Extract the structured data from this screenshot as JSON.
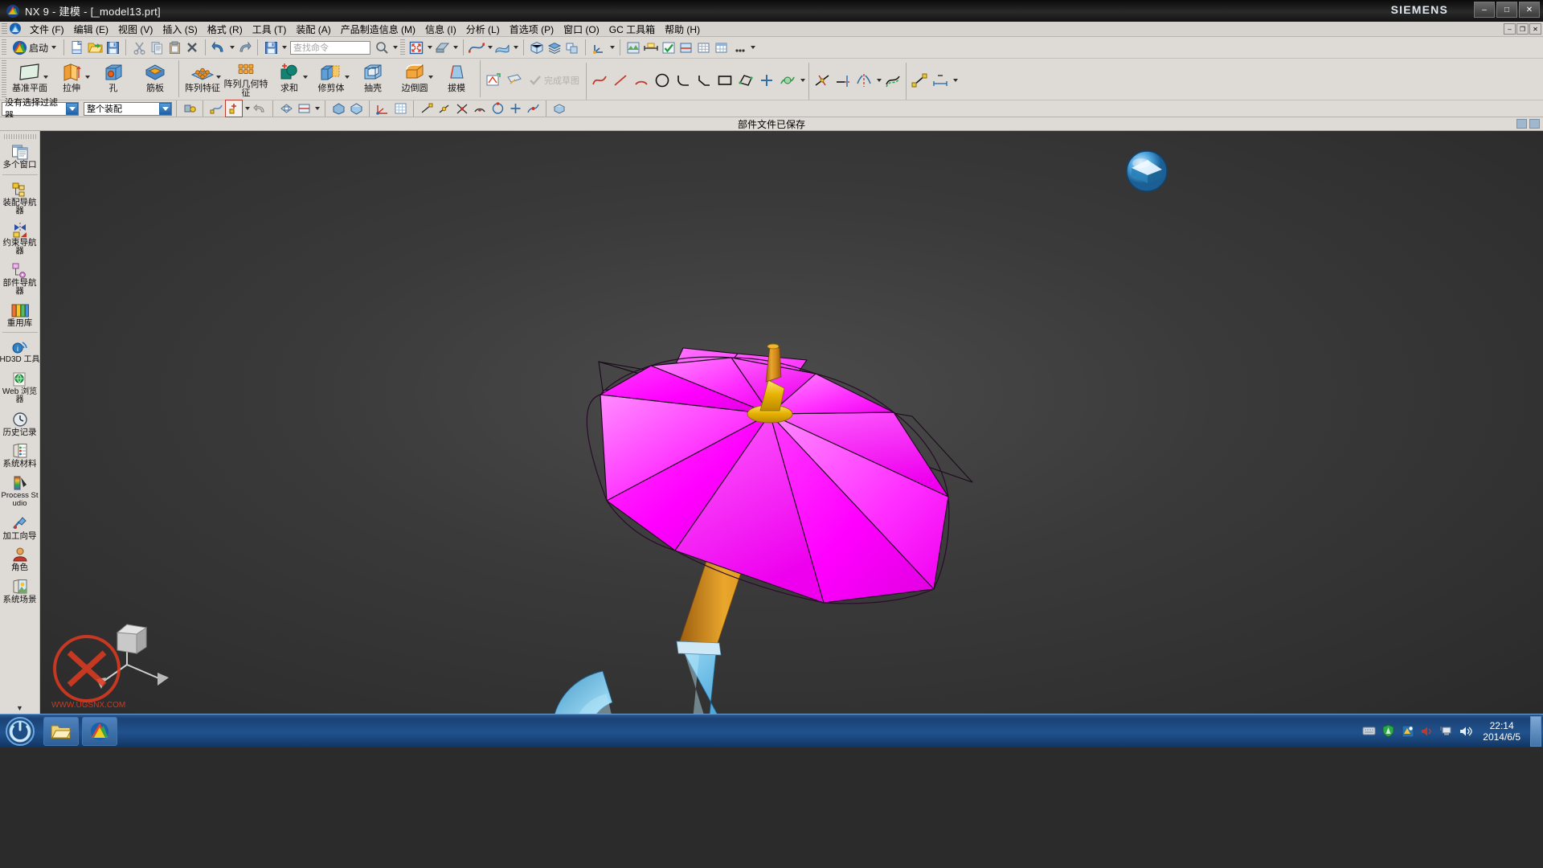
{
  "titlebar": {
    "title": "NX 9 - 建模 - [_model13.prt]",
    "brand": "SIEMENS",
    "icon": "nx-logo-icon",
    "buttons": [
      {
        "name": "minimize",
        "glyph": "–"
      },
      {
        "name": "maximize",
        "glyph": "□"
      },
      {
        "name": "close",
        "glyph": "✕"
      }
    ]
  },
  "menubar": {
    "app_icon": "nx-app-icon",
    "items": [
      {
        "label": "文件 (F)",
        "name": "menu-file"
      },
      {
        "label": "编辑 (E)",
        "name": "menu-edit"
      },
      {
        "label": "视图 (V)",
        "name": "menu-view"
      },
      {
        "label": "插入 (S)",
        "name": "menu-insert"
      },
      {
        "label": "格式 (R)",
        "name": "menu-format"
      },
      {
        "label": "工具 (T)",
        "name": "menu-tools"
      },
      {
        "label": "装配 (A)",
        "name": "menu-assemblies"
      },
      {
        "label": "产品制造信息 (M)",
        "name": "menu-pmi"
      },
      {
        "label": "信息 (I)",
        "name": "menu-information"
      },
      {
        "label": "分析 (L)",
        "name": "menu-analysis"
      },
      {
        "label": "首选项 (P)",
        "name": "menu-preferences"
      },
      {
        "label": "窗口 (O)",
        "name": "menu-window"
      },
      {
        "label": "GC 工具箱",
        "name": "menu-gc-toolkit"
      },
      {
        "label": "帮助 (H)",
        "name": "menu-help"
      }
    ],
    "window_buttons": [
      {
        "name": "doc-minimize",
        "glyph": "–"
      },
      {
        "name": "doc-restore",
        "glyph": "❐"
      },
      {
        "name": "doc-close",
        "glyph": "✕"
      }
    ]
  },
  "toolbar": {
    "start_label": "启动",
    "find_placeholder": "查找命令",
    "buttons": [
      {
        "name": "start-button",
        "icon": "nx-start-icon"
      },
      {
        "name": "new-button",
        "icon": "new-document-icon"
      },
      {
        "name": "open-button",
        "icon": "open-folder-icon"
      },
      {
        "name": "save-button",
        "icon": "save-disk-icon"
      },
      {
        "name": "cut-button",
        "icon": "scissors-icon"
      },
      {
        "name": "copy-button",
        "icon": "copy-icon"
      },
      {
        "name": "paste-button",
        "icon": "clipboard-icon"
      },
      {
        "name": "delete-button",
        "icon": "delete-x-icon"
      },
      {
        "name": "undo-button",
        "icon": "undo-arrow-icon"
      },
      {
        "name": "redo-button",
        "icon": "redo-arrow-icon"
      },
      {
        "name": "save-as-button",
        "icon": "save-disk-icon"
      },
      {
        "name": "find-command-input",
        "icon": "search-icon"
      },
      {
        "name": "search-button",
        "icon": "magnifier-icon"
      },
      {
        "name": "fit-view-button",
        "icon": "fit-window-icon"
      },
      {
        "name": "zoom-button",
        "icon": "zoom-icon"
      },
      {
        "name": "pan-button",
        "icon": "pan-hand-icon"
      },
      {
        "name": "rotate-button",
        "icon": "rotate-icon"
      },
      {
        "name": "perspective-button",
        "icon": "perspective-icon"
      },
      {
        "name": "shaded-button",
        "icon": "shaded-render-icon"
      },
      {
        "name": "orient-view-button",
        "icon": "orient-view-icon"
      },
      {
        "name": "layer-settings-button",
        "icon": "layers-icon"
      },
      {
        "name": "move-layer-button",
        "icon": "move-layer-icon"
      },
      {
        "name": "wcs-button",
        "icon": "wcs-icon"
      },
      {
        "name": "measure-button",
        "icon": "measure-icon"
      },
      {
        "name": "material-button",
        "icon": "material-icon"
      },
      {
        "name": "analysis-button",
        "icon": "analysis-icon"
      },
      {
        "name": "check-geometry-button",
        "icon": "check-icon"
      },
      {
        "name": "section-button",
        "icon": "section-icon"
      },
      {
        "name": "grid-button",
        "icon": "grid-icon"
      },
      {
        "name": "table-button",
        "icon": "table-icon"
      },
      {
        "name": "more-button",
        "icon": "more-icon"
      }
    ]
  },
  "ribbon": {
    "groups": [
      {
        "name": "feature-group",
        "items": [
          {
            "label": "基准平面",
            "name": "datum-plane",
            "icon": "datum-plane-icon",
            "dropdown": true
          },
          {
            "label": "拉伸",
            "name": "extrude",
            "icon": "extrude-icon",
            "dropdown": true
          },
          {
            "label": "孔",
            "name": "hole",
            "icon": "hole-icon",
            "dropdown": false
          },
          {
            "label": "筋板",
            "name": "rib",
            "icon": "rib-icon",
            "dropdown": false
          }
        ]
      },
      {
        "name": "detail-group",
        "items": [
          {
            "label": "阵列特征",
            "name": "pattern-feature",
            "icon": "pattern-feature-icon",
            "dropdown": true
          },
          {
            "label": "阵列几何特征",
            "name": "pattern-geometry",
            "icon": "pattern-geometry-icon",
            "dropdown": false
          },
          {
            "label": "求和",
            "name": "unite",
            "icon": "unite-icon",
            "dropdown": true
          },
          {
            "label": "修剪体",
            "name": "trim-body",
            "icon": "trim-body-icon",
            "dropdown": true
          },
          {
            "label": "抽壳",
            "name": "shell",
            "icon": "shell-icon",
            "dropdown": false
          },
          {
            "label": "边倒圆",
            "name": "edge-blend",
            "icon": "edge-blend-icon",
            "dropdown": true
          },
          {
            "label": "拔模",
            "name": "draft",
            "icon": "draft-icon",
            "dropdown": false
          }
        ]
      },
      {
        "name": "sketch-group",
        "items": [
          {
            "label": "完成草图",
            "name": "finish-sketch",
            "icon": "finish-sketch-icon"
          }
        ],
        "tools": [
          {
            "name": "sketch-in-task-icon",
            "icon": "sketch-task-icon"
          },
          {
            "name": "sketch-on-plane-icon",
            "icon": "sketch-plane-icon"
          },
          {
            "name": "profile-icon",
            "icon": "profile-curve-icon"
          },
          {
            "name": "line-icon",
            "icon": "line-icon"
          },
          {
            "name": "arc-icon",
            "icon": "arc-icon"
          },
          {
            "name": "circle-icon",
            "icon": "circle-icon"
          },
          {
            "name": "fillet-icon",
            "icon": "fillet-icon"
          },
          {
            "name": "chamfer-icon",
            "icon": "chamfer-icon"
          },
          {
            "name": "rectangle-icon",
            "icon": "rectangle-icon"
          },
          {
            "name": "polygon-icon",
            "icon": "polygon-icon"
          },
          {
            "name": "point-icon",
            "icon": "point-plus-icon"
          },
          {
            "name": "studio-spline-icon",
            "icon": "spline-icon"
          },
          {
            "name": "quick-trim-icon",
            "icon": "quick-trim-icon"
          },
          {
            "name": "quick-extend-icon",
            "icon": "quick-extend-icon"
          },
          {
            "name": "mirror-curve-icon",
            "icon": "mirror-curve-icon"
          },
          {
            "name": "offset-curve-icon",
            "icon": "offset-curve-icon"
          },
          {
            "name": "geometric-constraint-icon",
            "icon": "constraint-icon"
          },
          {
            "name": "dimension-icon",
            "icon": "dimension-icon"
          }
        ]
      }
    ]
  },
  "selection_bar": {
    "filter_value": "没有选择过滤器",
    "scope_value": "整个装配",
    "buttons": [
      {
        "name": "selection-priority-button",
        "icon": "selection-priority-icon"
      },
      {
        "name": "snap-point-button",
        "icon": "snap-point-icon",
        "active": true
      },
      {
        "name": "snap-arc-center-button",
        "icon": "arc-center-icon"
      },
      {
        "name": "snap-quadrant-button",
        "icon": "quadrant-icon"
      },
      {
        "name": "snap-existing-point-button",
        "icon": "existing-point-icon"
      },
      {
        "name": "snap-endpoint-button",
        "icon": "endpoint-icon"
      },
      {
        "name": "snap-midpoint-button",
        "icon": "midpoint-icon"
      },
      {
        "name": "snap-intersection-button",
        "icon": "intersection-icon"
      },
      {
        "name": "snap-center-button",
        "icon": "center-icon"
      },
      {
        "name": "snap-control-point-button",
        "icon": "control-point-icon"
      },
      {
        "name": "snap-tangent-button",
        "icon": "tangent-icon"
      },
      {
        "name": "snap-point-on-curve-button",
        "icon": "point-on-curve-icon"
      },
      {
        "name": "face-snap-button",
        "icon": "face-snap-icon"
      }
    ]
  },
  "cue_bar": {
    "message": "部件文件已保存"
  },
  "sidebar": {
    "groups": [
      {
        "items": [
          {
            "label": "多个窗口",
            "name": "sidebar-item-multiple-windows",
            "icon": "multiple-windows-icon"
          }
        ]
      },
      {
        "items": [
          {
            "label": "装配导航器",
            "name": "sidebar-item-assembly-navigator",
            "icon": "assembly-navigator-icon"
          },
          {
            "label": "约束导航器",
            "name": "sidebar-item-constraint-navigator",
            "icon": "constraint-navigator-icon"
          },
          {
            "label": "部件导航器",
            "name": "sidebar-item-part-navigator",
            "icon": "part-navigator-icon"
          },
          {
            "label": "重用库",
            "name": "sidebar-item-reuse-library",
            "icon": "reuse-library-icon"
          }
        ]
      },
      {
        "items": [
          {
            "label": "HD3D 工具",
            "name": "sidebar-item-hd3d-tools",
            "icon": "hd3d-tools-icon"
          },
          {
            "label": "Web 浏览器",
            "name": "sidebar-item-web-browser",
            "icon": "web-browser-icon"
          },
          {
            "label": "历史记录",
            "name": "sidebar-item-history",
            "icon": "history-clock-icon"
          },
          {
            "label": "系统材料",
            "name": "sidebar-item-system-materials",
            "icon": "system-materials-icon"
          },
          {
            "label": "Process Studio",
            "name": "sidebar-item-process-studio",
            "icon": "process-studio-icon"
          },
          {
            "label": "加工向导",
            "name": "sidebar-item-machining-wizard",
            "icon": "machining-wizard-icon"
          },
          {
            "label": "角色",
            "name": "sidebar-item-roles",
            "icon": "roles-icon"
          },
          {
            "label": "系统场景",
            "name": "sidebar-item-system-scenes",
            "icon": "system-scenes-icon"
          }
        ]
      }
    ],
    "scroll_arrow": "▼"
  },
  "canvas": {
    "view_cube_name": "view-orientation-widget",
    "triad_name": "wcs-triad",
    "model_name": "umbrella-model",
    "colors": {
      "canopy": "#FF00FF",
      "canopy_light": "#FF6BFF",
      "shaft": "#D08A1E",
      "shaft_light": "#E8A93A",
      "handle": "#55AEE0",
      "handle_light": "#9FD8F2",
      "ferrule": "#E8B400",
      "background_top": "#4c4c4c",
      "background_bottom": "#2a2a2a"
    },
    "watermark": "UG  WWW.UGSNX.COM"
  },
  "taskbar": {
    "start_name": "start-orb",
    "tasks": [
      {
        "name": "taskbar-explorer",
        "icon": "folder-icon"
      },
      {
        "name": "taskbar-nx",
        "icon": "nx-logo-icon"
      }
    ],
    "tray_icons": [
      {
        "name": "keyboard-icon"
      },
      {
        "name": "shield-icon"
      },
      {
        "name": "media-icon"
      },
      {
        "name": "volume-mute-icon"
      },
      {
        "name": "network-icon"
      },
      {
        "name": "volume-icon"
      }
    ],
    "clock_time": "22:14",
    "clock_date": "2014/6/5"
  }
}
